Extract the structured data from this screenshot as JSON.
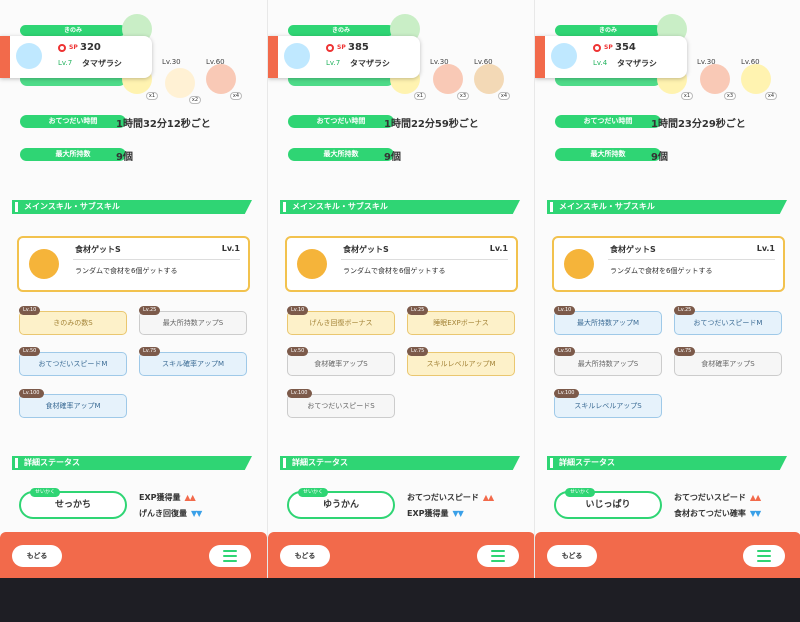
{
  "panels": [
    {
      "berry_label": "きのみ",
      "sp_label": "SP",
      "sp_value": "320",
      "level": "Lv.7",
      "name": "タマザラシ",
      "unlocks": [
        "Lv.30",
        "Lv.60"
      ],
      "ingredient_counts": [
        "x1",
        "x2",
        "x4"
      ],
      "help_time_label": "おてつだい時間",
      "help_time": "1時間32分12秒ごと",
      "max_carry_label": "最大所持数",
      "max_carry": "9個",
      "skills_section": "メインスキル・サブスキル",
      "main_skill": {
        "name": "食材ゲットS",
        "level": "Lv.1",
        "desc": "ランダムで食材を6個ゲットする"
      },
      "subskills": [
        {
          "lv": "Lv.10",
          "name": "きのみの数S"
        },
        {
          "lv": "Lv.25",
          "name": "最大所持数アップS"
        },
        {
          "lv": "Lv.50",
          "name": "おてつだいスピードM"
        },
        {
          "lv": "Lv.75",
          "name": "スキル確率アップM"
        },
        {
          "lv": "Lv.100",
          "name": "食材確率アップM"
        }
      ],
      "details_section": "詳細ステータス",
      "nature_tag": "せいかく",
      "nature": "せっかち",
      "stat_up": "EXP獲得量",
      "stat_down": "げんき回復量",
      "up_arrows": "▲▲",
      "down_arrows": "▼▼",
      "back": "もどる"
    },
    {
      "berry_label": "きのみ",
      "sp_label": "SP",
      "sp_value": "385",
      "level": "Lv.7",
      "name": "タマザラシ",
      "unlocks": [
        "Lv.30",
        "Lv.60"
      ],
      "ingredient_counts": [
        "x1",
        "x3",
        "x4"
      ],
      "help_time_label": "おてつだい時間",
      "help_time": "1時間22分59秒ごと",
      "max_carry_label": "最大所持数",
      "max_carry": "9個",
      "skills_section": "メインスキル・サブスキル",
      "main_skill": {
        "name": "食材ゲットS",
        "level": "Lv.1",
        "desc": "ランダムで食材を6個ゲットする"
      },
      "subskills": [
        {
          "lv": "Lv.10",
          "name": "げんき回復ボーナス"
        },
        {
          "lv": "Lv.25",
          "name": "睡眠EXPボーナス"
        },
        {
          "lv": "Lv.50",
          "name": "食材確率アップS"
        },
        {
          "lv": "Lv.75",
          "name": "スキルレベルアップM"
        },
        {
          "lv": "Lv.100",
          "name": "おてつだいスピードS"
        }
      ],
      "details_section": "詳細ステータス",
      "nature_tag": "せいかく",
      "nature": "ゆうかん",
      "stat_up": "おてつだいスピード",
      "stat_down": "EXP獲得量",
      "up_arrows": "▲▲",
      "down_arrows": "▼▼",
      "back": "もどる"
    },
    {
      "berry_label": "きのみ",
      "sp_label": "SP",
      "sp_value": "354",
      "level": "Lv.4",
      "name": "タマザラシ",
      "unlocks": [
        "Lv.30",
        "Lv.60"
      ],
      "ingredient_counts": [
        "x1",
        "x3",
        "x4"
      ],
      "help_time_label": "おてつだい時間",
      "help_time": "1時間23分29秒ごと",
      "max_carry_label": "最大所持数",
      "max_carry": "9個",
      "skills_section": "メインスキル・サブスキル",
      "main_skill": {
        "name": "食材ゲットS",
        "level": "Lv.1",
        "desc": "ランダムで食材を6個ゲットする"
      },
      "subskills": [
        {
          "lv": "Lv.10",
          "name": "最大所持数アップM"
        },
        {
          "lv": "Lv.25",
          "name": "おてつだいスピードM"
        },
        {
          "lv": "Lv.50",
          "name": "最大所持数アップS"
        },
        {
          "lv": "Lv.75",
          "name": "食材確率アップS"
        },
        {
          "lv": "Lv.100",
          "name": "スキルレベルアップS"
        }
      ],
      "details_section": "詳細ステータス",
      "nature_tag": "せいかく",
      "nature": "いじっぱり",
      "stat_up": "おてつだいスピード",
      "stat_down": "食材おてつだい確率",
      "up_arrows": "▲▲",
      "down_arrows": "▼▼",
      "back": "もどる"
    }
  ],
  "colors": {
    "accent_green": "#2fd574",
    "footer_orange": "#f26a4b",
    "gold_subskill": "#fdf1c9",
    "blue_subskill": "#e6f2fb",
    "white_subskill": "#f6f6f6"
  },
  "icons": [
    "berry-icon",
    "ingredient-icon",
    "sp-icon",
    "lock-icon",
    "skill-apple-icon",
    "menu-icon"
  ]
}
